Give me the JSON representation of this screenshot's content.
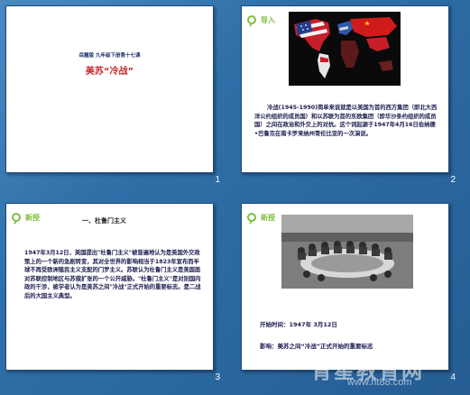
{
  "slides": [
    {
      "number": "1",
      "subtitle": "岳麓版 九年级下册第十七课",
      "title": "美苏“冷战”"
    },
    {
      "number": "2",
      "badge": "导入",
      "paragraph": "冷战(1945-1990)简单来说就是以美国为首的西方集团（即北大西洋公约组织的成员国）和以苏联为首的东欧集团（即华沙条约组织的成员国）之间在政治和外交上的对抗。这个词起源于1947年4月16日伯纳德•巴鲁克在南卡罗来纳州哥伦比亚的一次演说。"
    },
    {
      "number": "3",
      "badge": "新授",
      "heading": "一、杜鲁门主义",
      "paragraph": "1947年3月12日，美国提出\"杜鲁门主义\"被普遍地认为是美国外交政策上的一个新的急剧转变，其对全世界的影响相当于1823年宣布而半球不再受欧洲殖民主义支配的门罗主义。苏联认为杜鲁门主义是美国面对苏联控制地区与苏俄扩张的一个公开威胁。\"杜鲁门主义\"是对别国内政的干涉，被学者认为是美苏之间\"冷战\"正式开始的重要标志。是二战后的大国主义典型。"
    },
    {
      "number": "4",
      "badge": "新授",
      "start_time": "开始时间：1947年 3月12日",
      "impact": "影响：美苏之间“冷战”正式开始的重要标志"
    }
  ],
  "watermark": {
    "text": "育星教育网",
    "url": "www.ht88.com"
  }
}
